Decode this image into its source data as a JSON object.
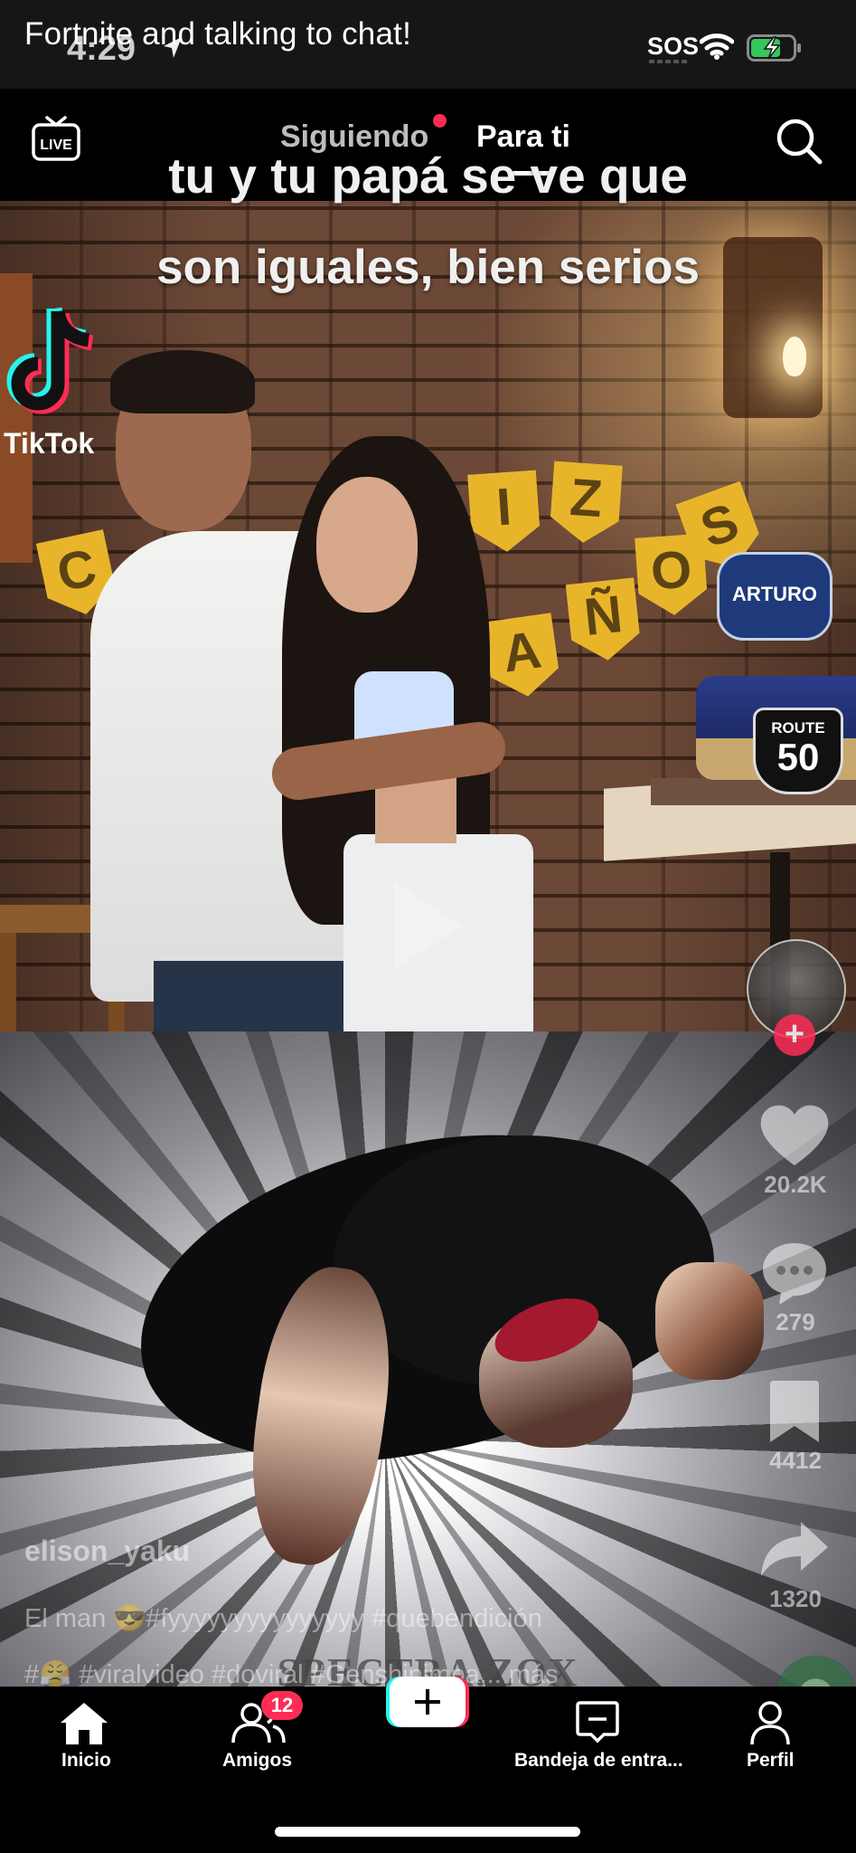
{
  "status_bar": {
    "notification": "Fortnite and talking to chat!",
    "time": "4:29",
    "sos": "SOS",
    "battery": "charging"
  },
  "top_nav": {
    "live_label": "LIVE",
    "tab_following": "Siguiendo",
    "tab_for_you": "Para ti",
    "active_tab": "Para ti"
  },
  "video_top": {
    "caption_line1": "tu y tu papá se ve que",
    "caption_line2": "son iguales, bien serios",
    "watermark": "TikTok",
    "banner_letters": [
      "C",
      "I",
      "Z",
      "A",
      "Ñ",
      "O",
      "S"
    ],
    "badge_text": "ARTURO",
    "sign_route": "ROUTE",
    "sign_number": "50"
  },
  "video_bottom": {
    "watermark": "SPECTRA.ZOX"
  },
  "right_rail": {
    "likes": "20.2K",
    "comments": "279",
    "saves": "4412",
    "shares": "1320"
  },
  "post": {
    "username": "elison_yaku",
    "description_line1": "El man 😎#fyyyyyyyyyyyyyyy #quebendición",
    "description_line2": "#😤 #viralvideo #doviral #Genshinimpa... más"
  },
  "bottom_nav": {
    "home": "Inicio",
    "friends": "Amigos",
    "friends_badge": "12",
    "inbox": "Bandeja de entra...",
    "profile": "Perfil"
  },
  "colors": {
    "accent": "#fe2c55",
    "accent_cyan": "#25f4ee",
    "background": "#000000"
  }
}
